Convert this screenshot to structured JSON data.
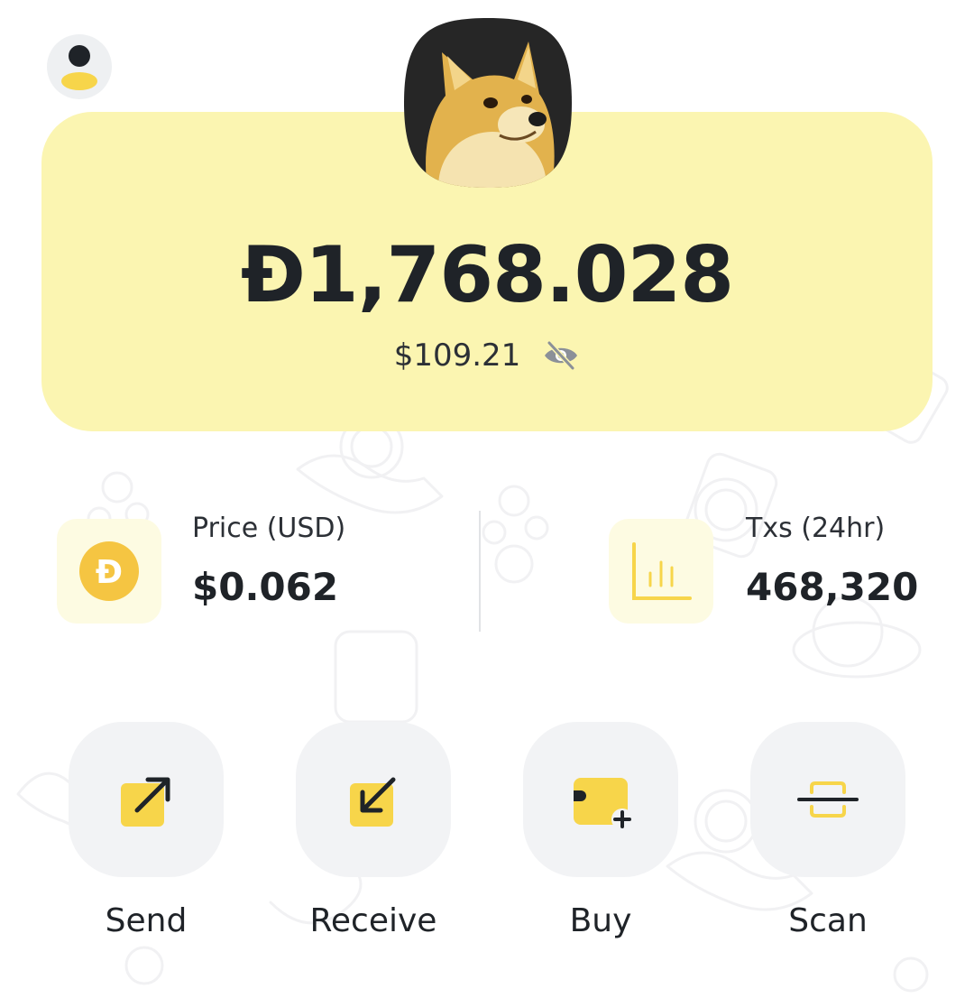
{
  "header": {
    "profile_icon": "user-icon"
  },
  "balance": {
    "coin_image": "doge-avatar",
    "amount": "Đ1,768.028",
    "fiat_value": "$109.21",
    "visibility_icon": "eye-off-icon"
  },
  "stats": {
    "price": {
      "icon": "dogecoin-icon",
      "label": "Price (USD)",
      "value": "$0.062"
    },
    "transactions": {
      "icon": "bar-chart-icon",
      "label": "Txs (24hr)",
      "value": "468,320"
    }
  },
  "actions": [
    {
      "label": "Send",
      "icon": "send-arrow-icon"
    },
    {
      "label": "Receive",
      "icon": "receive-arrow-icon"
    },
    {
      "label": "Buy",
      "icon": "buy-card-icon"
    },
    {
      "label": "Scan",
      "icon": "scan-icon"
    }
  ],
  "colors": {
    "card_background": "#fbf5b1",
    "accent_yellow": "#f7d54a",
    "text_dark": "#1f2328",
    "button_background": "#f2f3f5"
  }
}
